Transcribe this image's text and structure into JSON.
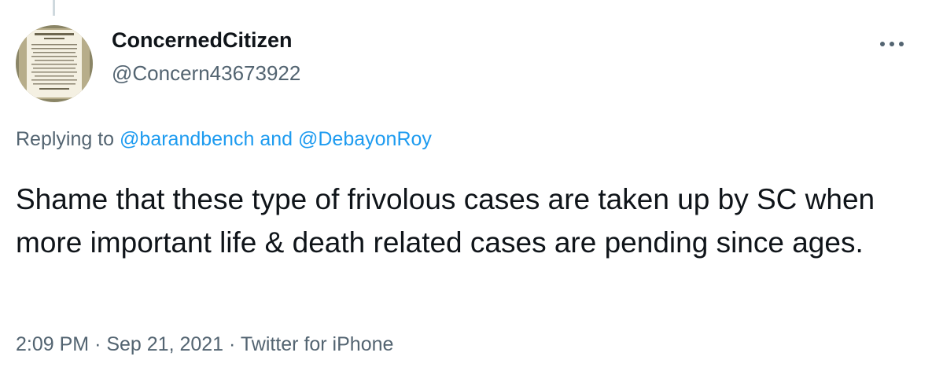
{
  "user": {
    "display_name": "ConcernedCitizen",
    "handle": "@Concern43673922",
    "avatar_icon": "constitution-preamble-image"
  },
  "more_icon": "more-horizontal-icon",
  "reply": {
    "prefix": "Replying to",
    "mention_1": "@barandbench",
    "joiner": "and",
    "mention_2": "@DebayonRoy"
  },
  "tweet": {
    "text": "Shame that these type of frivolous cases are taken up by SC when more important life & death related cases are pending since ages."
  },
  "meta": {
    "time": "2:09 PM",
    "separator": "·",
    "date": "Sep 21, 2021",
    "source": "Twitter for iPhone"
  },
  "colors": {
    "link": "#1d9bf0",
    "secondary_text": "#536471",
    "primary_text": "#0f1419",
    "thread_line": "#cfd9de"
  }
}
